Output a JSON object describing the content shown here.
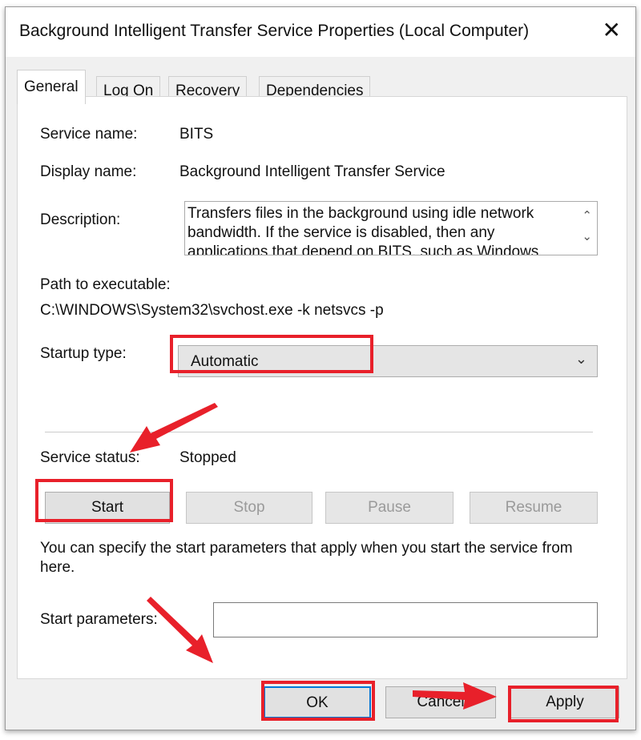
{
  "window": {
    "title": "Background Intelligent Transfer Service Properties (Local Computer)",
    "close": "✕"
  },
  "tabs": [
    {
      "label": "General",
      "active": true
    },
    {
      "label": "Log On"
    },
    {
      "label": "Recovery"
    },
    {
      "label": "Dependencies"
    }
  ],
  "general": {
    "service_name_label": "Service name:",
    "service_name": "BITS",
    "display_name_label": "Display name:",
    "display_name": "Background Intelligent Transfer Service",
    "description_label": "Description:",
    "description": "Transfers files in the background using idle network bandwidth. If the service is disabled, then any applications that depend on BITS, such as Windows",
    "path_label": "Path to executable:",
    "path": "C:\\WINDOWS\\System32\\svchost.exe -k netsvcs -p",
    "startup_type_label": "Startup type:",
    "startup_type": "Automatic",
    "status_label": "Service status:",
    "status": "Stopped",
    "buttons": {
      "start": "Start",
      "stop": "Stop",
      "pause": "Pause",
      "resume": "Resume"
    },
    "hint": "You can specify the start parameters that apply when you start the service from here.",
    "start_params_label": "Start parameters:",
    "start_params": ""
  },
  "footer": {
    "ok": "OK",
    "cancel": "Cancel",
    "apply": "Apply"
  },
  "colors": {
    "highlight": "#e8202a",
    "focus": "#0078d7"
  }
}
